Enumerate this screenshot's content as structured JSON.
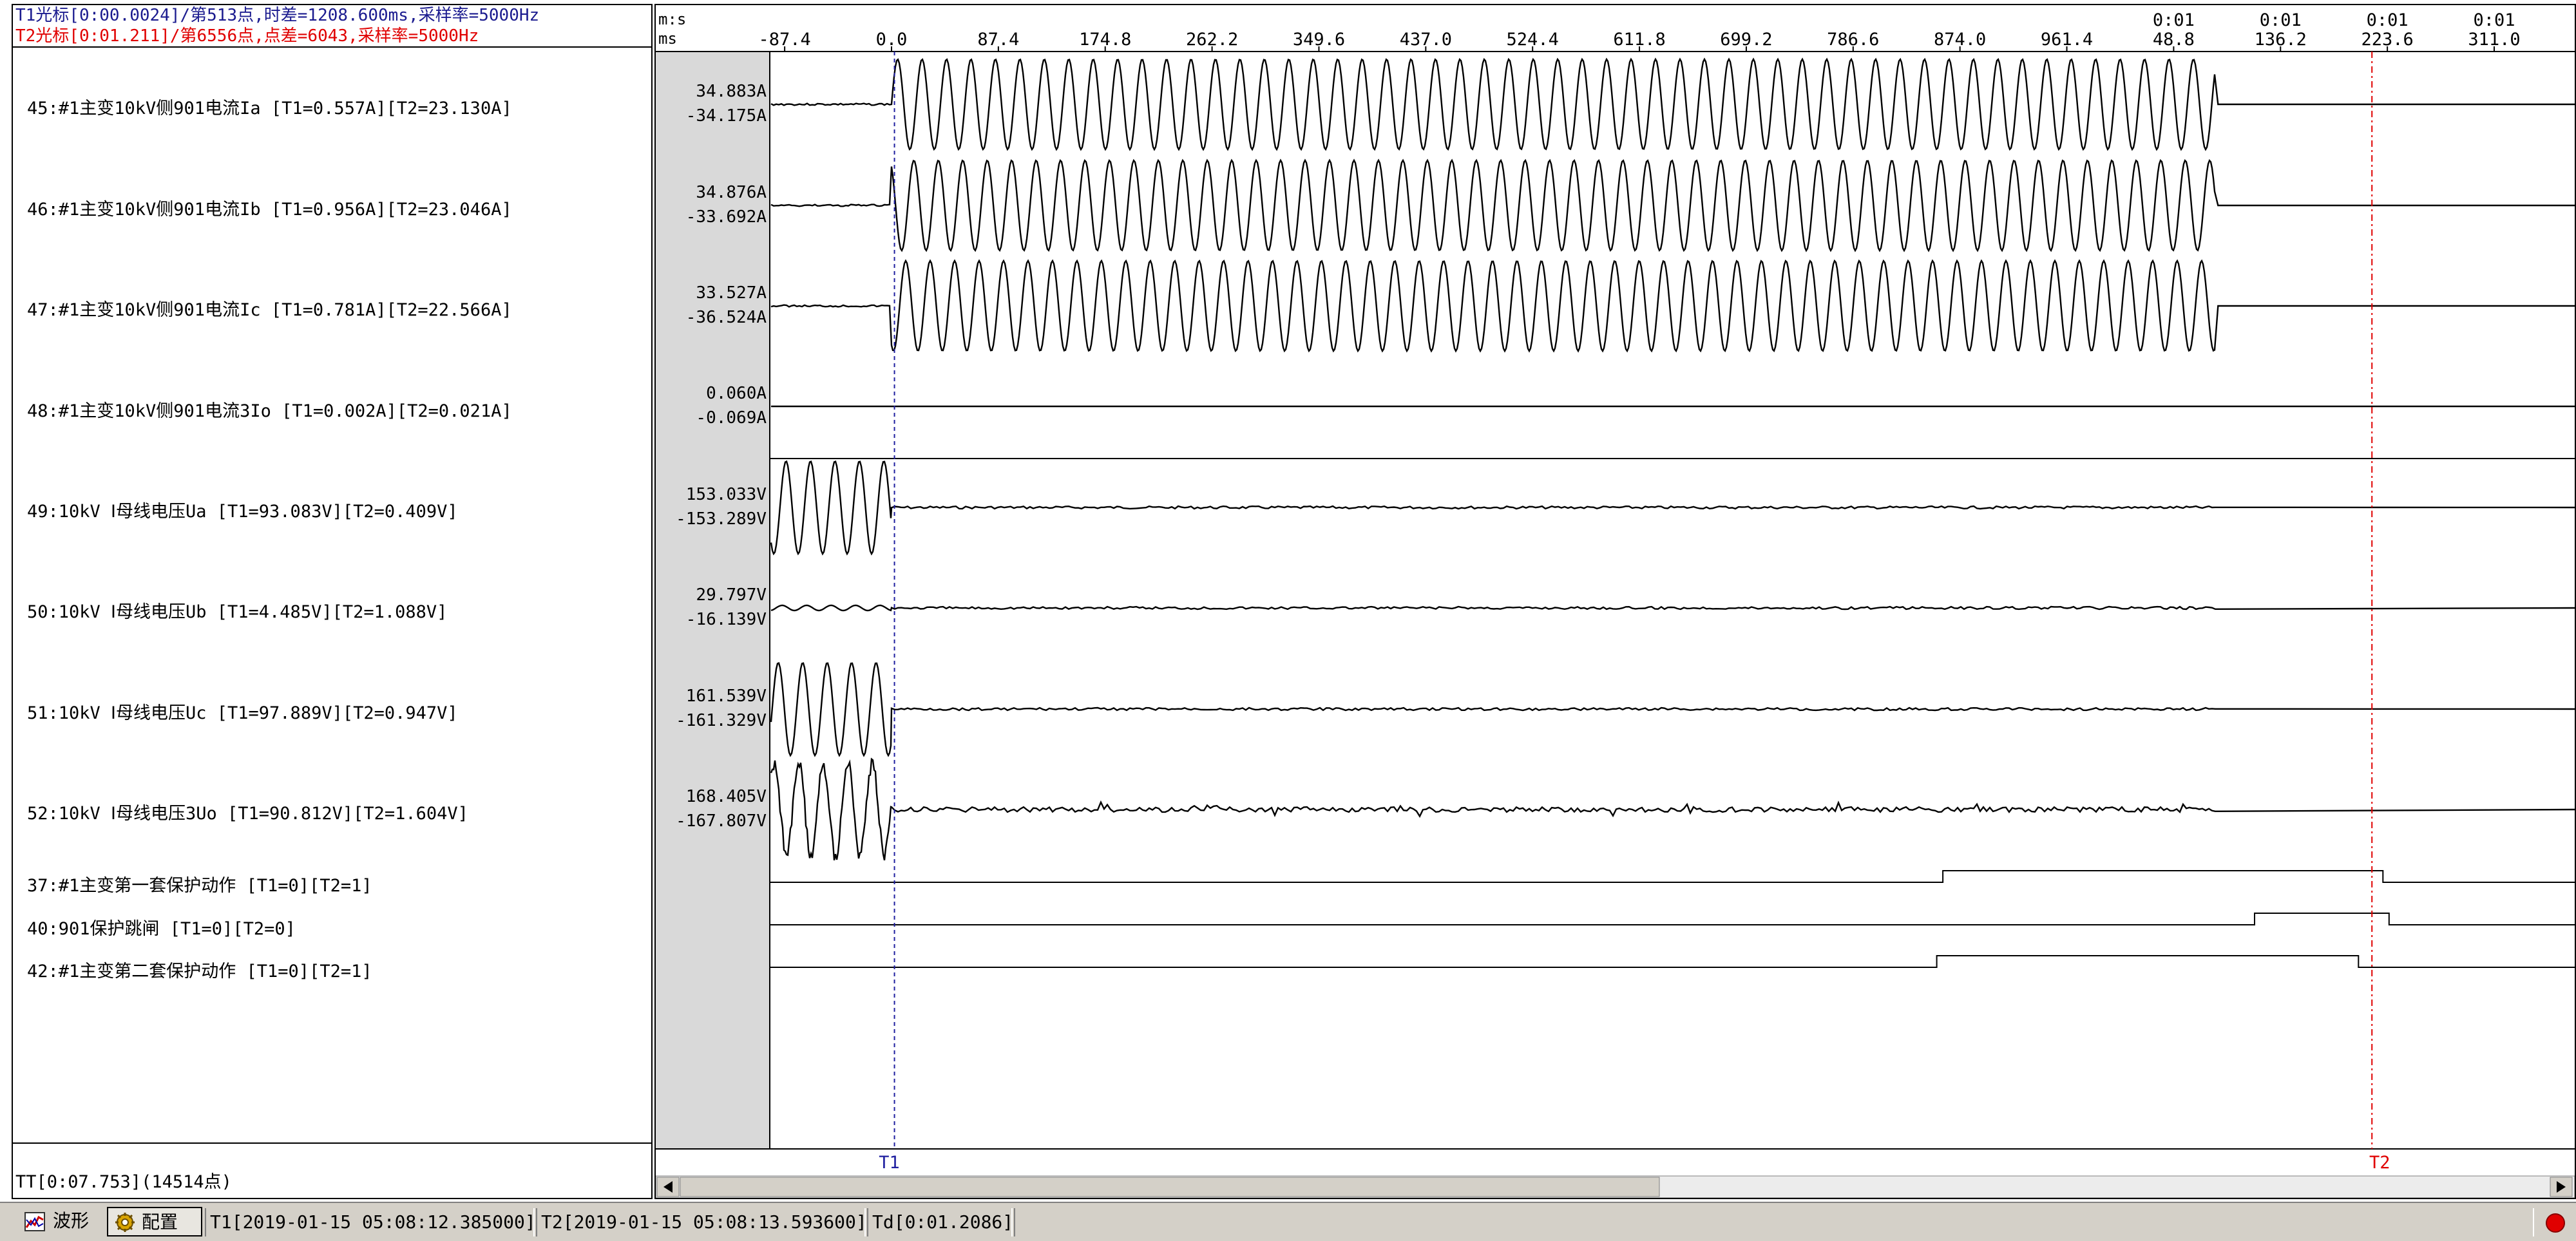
{
  "cursor_info": {
    "t1": "T1光标[0:00.0024]/第513点,时差=1208.600ms,采样率=5000Hz",
    "t2": "T2光标[0:01.211]/第6556点,点差=6043,采样率=5000Hz"
  },
  "channels": [
    {
      "label": "45:#1主变10kV侧901电流Ia [T1=0.557A][T2=23.130A]",
      "max": "34.883A",
      "min": "-34.175A",
      "kind": "current"
    },
    {
      "label": "46:#1主变10kV侧901电流Ib [T1=0.956A][T2=23.046A]",
      "max": "34.876A",
      "min": "-33.692A",
      "kind": "current"
    },
    {
      "label": "47:#1主变10kV侧901电流Ic [T1=0.781A][T2=22.566A]",
      "max": "33.527A",
      "min": "-36.524A",
      "kind": "current"
    },
    {
      "label": "48:#1主变10kV侧901电流3Io [T1=0.002A][T2=0.021A]",
      "max": "0.060A",
      "min": "-0.069A",
      "kind": "flat"
    },
    {
      "label": "49:10kV Ⅰ母线电压Ua [T1=93.083V][T2=0.409V]",
      "max": "153.033V",
      "min": "-153.289V",
      "kind": "voltage"
    },
    {
      "label": "50:10kV Ⅰ母线电压Ub [T1=4.485V][T2=1.088V]",
      "max": "29.797V",
      "min": "-16.139V",
      "kind": "voltage-small"
    },
    {
      "label": "51:10kV Ⅰ母线电压Uc [T1=97.889V][T2=0.947V]",
      "max": "161.539V",
      "min": "-161.329V",
      "kind": "voltage"
    },
    {
      "label": "52:10kV Ⅰ母线电压3Uo [T1=90.812V][T2=1.604V]",
      "max": "168.405V",
      "min": "-167.807V",
      "kind": "voltage-noisy"
    }
  ],
  "digital_channels": [
    {
      "label": "37:#1主变第一套保护动作 [T1=0][T2=1]",
      "pulse_start_ms": 860,
      "pulse_end_ms": 1220
    },
    {
      "label": "40:901保护跳闸 [T1=0][T2=0]",
      "pulse_start_ms": 1115,
      "pulse_end_ms": 1225
    },
    {
      "label": "42:#1主变第二套保护动作 [T1=0][T2=1]",
      "pulse_start_ms": 855,
      "pulse_end_ms": 1200
    }
  ],
  "time_axis": {
    "unit_top": "m:s",
    "unit_bottom": "ms",
    "ticks": [
      {
        "ms": -87.4,
        "label": "-87.4"
      },
      {
        "ms": 0.0,
        "label": "0.0"
      },
      {
        "ms": 87.4,
        "label": "87.4"
      },
      {
        "ms": 174.8,
        "label": "174.8"
      },
      {
        "ms": 262.2,
        "label": "262.2"
      },
      {
        "ms": 349.6,
        "label": "349.6"
      },
      {
        "ms": 437.0,
        "label": "437.0"
      },
      {
        "ms": 524.4,
        "label": "524.4"
      },
      {
        "ms": 611.8,
        "label": "611.8"
      },
      {
        "ms": 699.2,
        "label": "699.2"
      },
      {
        "ms": 786.6,
        "label": "786.6"
      },
      {
        "ms": 874.0,
        "label": "874.0"
      },
      {
        "ms": 961.4,
        "label": "961.4"
      },
      {
        "ms": 1048.8,
        "label": "48.8",
        "top": "0:01"
      },
      {
        "ms": 1136.2,
        "label": "136.2",
        "top": "0:01"
      },
      {
        "ms": 1223.6,
        "label": "223.6",
        "top": "0:01"
      },
      {
        "ms": 1311.0,
        "label": "311.0",
        "top": "0:01"
      }
    ],
    "range_ms": [
      -87.4,
      1311.0
    ],
    "current_end_ms": 1083,
    "fault_start_ms": 0
  },
  "cursors": {
    "t1": {
      "label": "T1",
      "ms": 2.4,
      "color": "#2020a0"
    },
    "t2": {
      "label": "T2",
      "ms": 1211,
      "color": "#e00000"
    }
  },
  "footer": {
    "tt": "TT[0:07.753](14514点)",
    "wave_tab": "波形",
    "config_tab": "配置",
    "t1_time": "T1[2019-01-15 05:08:12.385000]",
    "t2_time": "T2[2019-01-15 05:08:13.593600]",
    "td_time": "Td[0:01.2086]"
  },
  "colors": {
    "t1_text": "#1b1b8f",
    "t2_text": "#e00000",
    "status_indicator": "#e00000"
  }
}
